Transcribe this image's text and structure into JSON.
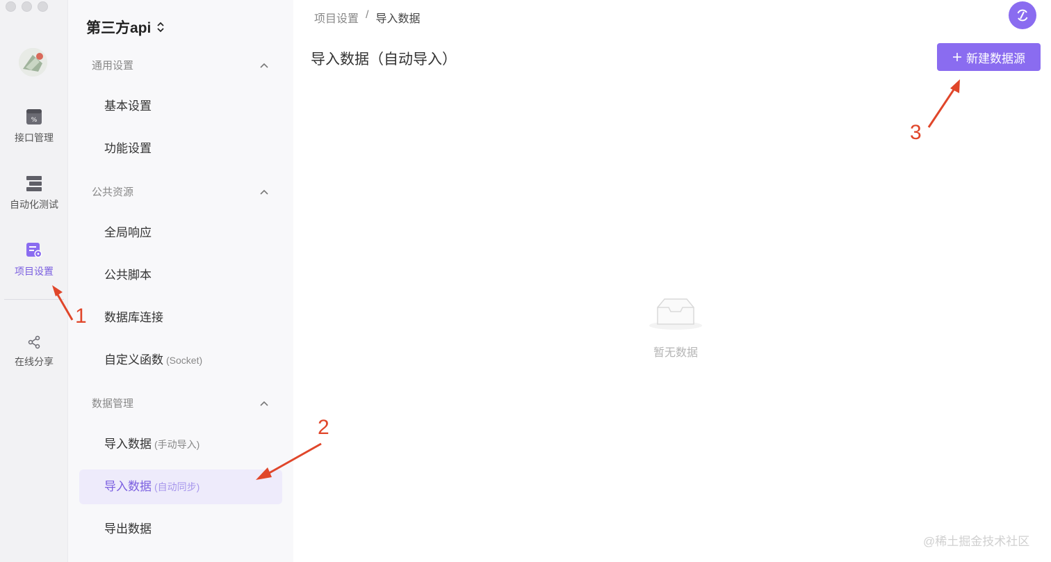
{
  "rail": {
    "items": [
      {
        "label": "接口管理",
        "icon": "api-management-icon"
      },
      {
        "label": "自动化测试",
        "icon": "automation-test-icon"
      },
      {
        "label": "项目设置",
        "icon": "project-settings-icon",
        "active": true
      },
      {
        "label": "在线分享",
        "icon": "share-icon"
      }
    ]
  },
  "sidebar": {
    "project_name": "第三方api",
    "groups": [
      {
        "title": "通用设置",
        "items": [
          {
            "label": "基本设置",
            "sub": ""
          },
          {
            "label": "功能设置",
            "sub": ""
          }
        ]
      },
      {
        "title": "公共资源",
        "items": [
          {
            "label": "全局响应",
            "sub": ""
          },
          {
            "label": "公共脚本",
            "sub": ""
          },
          {
            "label": "数据库连接",
            "sub": ""
          },
          {
            "label": "自定义函数",
            "sub": "(Socket)"
          }
        ]
      },
      {
        "title": "数据管理",
        "items": [
          {
            "label": "导入数据",
            "sub": "(手动导入)"
          },
          {
            "label": "导入数据",
            "sub": "(自动同步)"
          },
          {
            "label": "导出数据",
            "sub": ""
          }
        ]
      }
    ]
  },
  "main": {
    "breadcrumb": [
      "项目设置",
      "/",
      "导入数据"
    ],
    "title": "导入数据（自动导入）",
    "new_button": "新建数据源",
    "empty_text": "暂无数据"
  },
  "annotations": [
    "1",
    "2",
    "3"
  ],
  "watermark": "@稀土掘金技术社区",
  "colors": {
    "accent": "#8a6cf0",
    "annotation": "#e0462a",
    "active_bg": "#eeebfb"
  }
}
